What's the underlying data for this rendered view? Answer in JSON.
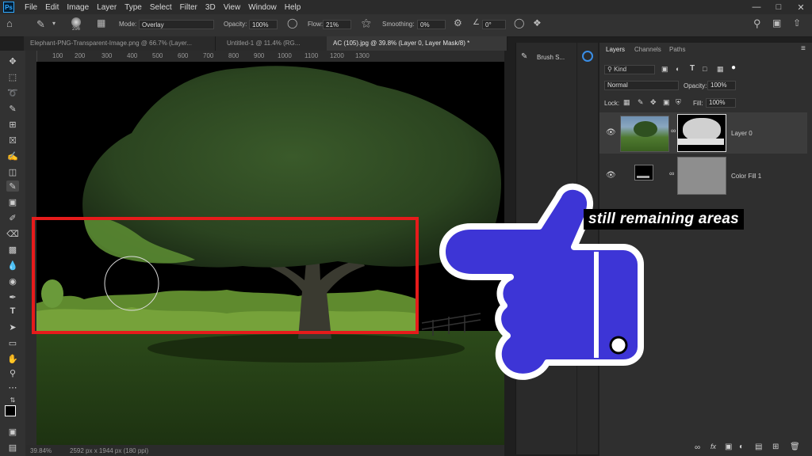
{
  "menubar": {
    "logo": "Ps",
    "items": [
      "File",
      "Edit",
      "Image",
      "Layer",
      "Type",
      "Select",
      "Filter",
      "3D",
      "View",
      "Window",
      "Help"
    ]
  },
  "options": {
    "brush_size": "296",
    "mode_label": "Mode:",
    "mode_value": "Overlay",
    "opacity_label": "Opacity:",
    "opacity_value": "100%",
    "flow_label": "Flow:",
    "flow_value": "21%",
    "smoothing_label": "Smoothing:",
    "smoothing_value": "0%",
    "angle_value": "0°"
  },
  "tabs": [
    {
      "label": "Elephant-PNG-Transparent-Image.png @ 66.7% (Layer..."
    },
    {
      "label": "Untitled-1 @ 11.4% (RG..."
    },
    {
      "label": "AC (105).jpg @ 39.8% (Layer 0, Layer Mask/8) *"
    }
  ],
  "ruler": {
    "ticks": [
      "100",
      "200",
      "300",
      "400",
      "500",
      "600",
      "700",
      "800",
      "900",
      "1000",
      "1100",
      "1200",
      "1300"
    ]
  },
  "status": {
    "zoom": "39.84%",
    "doc_size": "2592 px x 1944 px (180 ppi)"
  },
  "brush_panel": {
    "label": "Brush S..."
  },
  "layers": {
    "tabs": [
      "Layers",
      "Channels",
      "Paths"
    ],
    "filter": "Kind",
    "blend_mode": "Normal",
    "opacity_label": "Opacity:",
    "opacity_value": "100%",
    "lock_label": "Lock:",
    "fill_label": "Fill:",
    "fill_value": "100%",
    "items": [
      {
        "name": "Layer 0"
      },
      {
        "name": "Color Fill 1"
      }
    ]
  },
  "annotation": {
    "text": "still remaining areas",
    "box_color": "#e61b1b",
    "hand_color": "#3d35d6"
  }
}
